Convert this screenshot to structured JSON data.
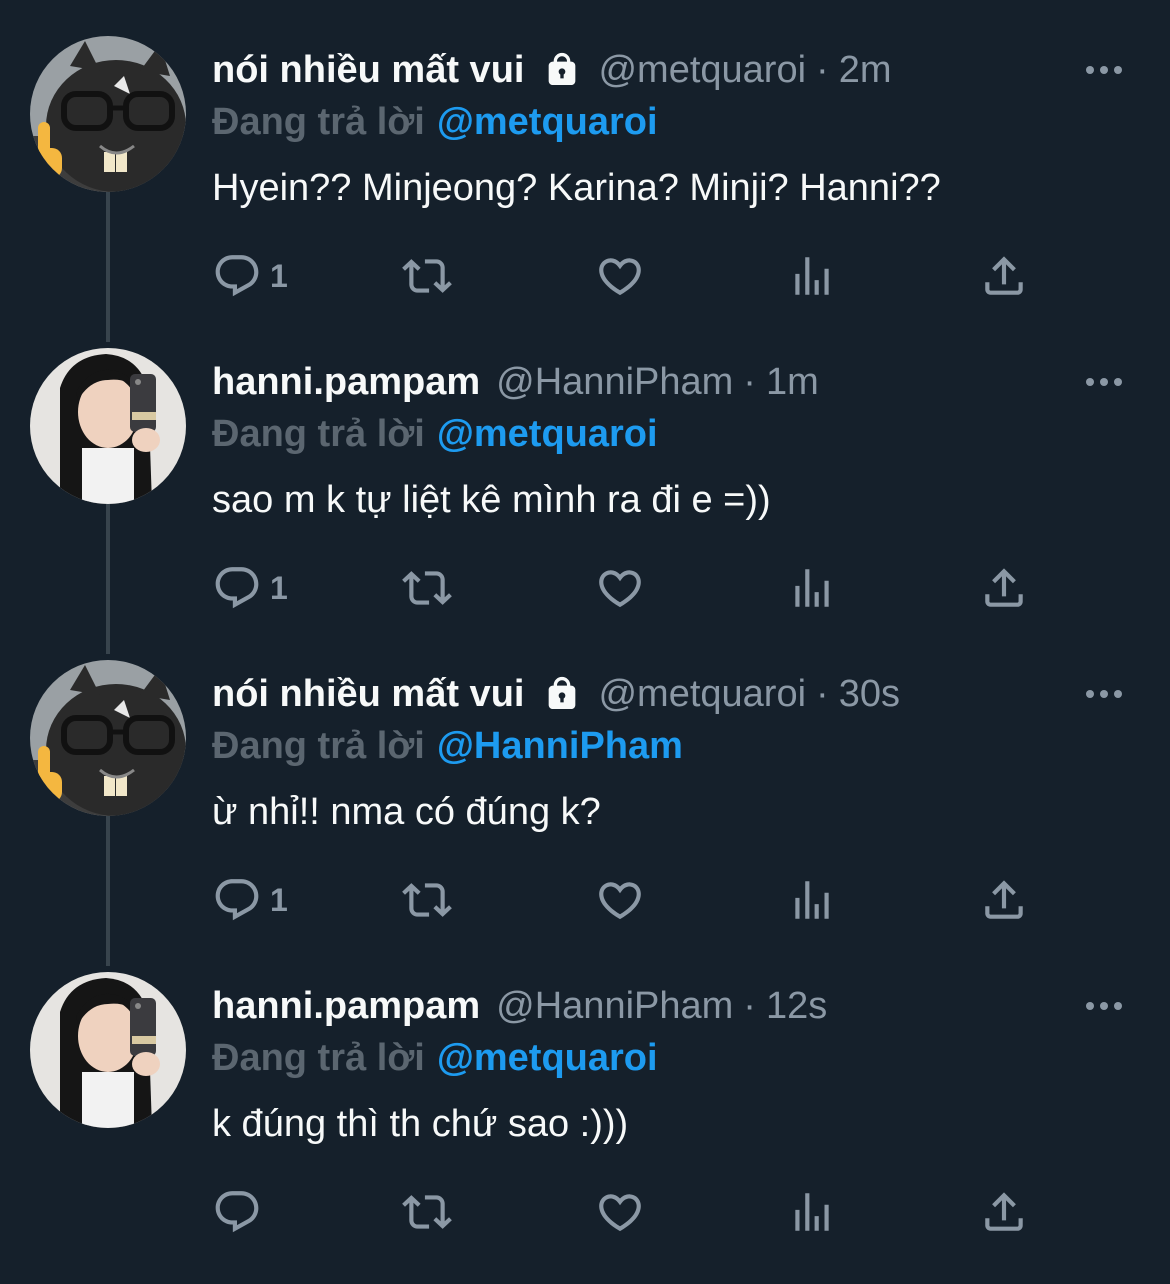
{
  "tweets": [
    {
      "display_name": "nói nhiều mất vui",
      "protected": true,
      "handle": "@metquaroi",
      "separator": "·",
      "time": "2m",
      "reply_prefix": "Đang trả lời",
      "reply_to": "@metquaroi",
      "text": "Hyein?? Minjeong? Karina? Minji? Hanni??",
      "reply_count": "1",
      "avatar": "cat-with-glasses-avatar"
    },
    {
      "display_name": "hanni.pampam",
      "protected": false,
      "handle": "@HanniPham",
      "separator": "·",
      "time": "1m",
      "reply_prefix": "Đang trả lời",
      "reply_to": "@metquaroi",
      "text": "sao m k tự liệt kê mình ra đi e =))",
      "reply_count": "1",
      "avatar": "girl-selfie-avatar"
    },
    {
      "display_name": "nói nhiều mất vui",
      "protected": true,
      "handle": "@metquaroi",
      "separator": "·",
      "time": "30s",
      "reply_prefix": "Đang trả lời",
      "reply_to": "@HanniPham",
      "text": "ừ nhỉ!! nma có đúng k?",
      "reply_count": "1",
      "avatar": "cat-with-glasses-avatar"
    },
    {
      "display_name": "hanni.pampam",
      "protected": false,
      "handle": "@HanniPham",
      "separator": "·",
      "time": "12s",
      "reply_prefix": "Đang trả lời",
      "reply_to": "@metquaroi",
      "text": "k đúng thì th chứ sao :)))",
      "reply_count": "",
      "avatar": "girl-selfie-avatar"
    }
  ],
  "icons": {
    "more": "more-icon",
    "lock": "lock-icon",
    "reply": "reply-icon",
    "retweet": "retweet-icon",
    "like": "like-icon",
    "views": "views-icon",
    "share": "share-icon"
  },
  "colors": {
    "background": "#15202b",
    "text": "#f7f9f9",
    "muted": "#8b98a5",
    "link": "#1d9bf0",
    "thread_line": "#38444d"
  }
}
